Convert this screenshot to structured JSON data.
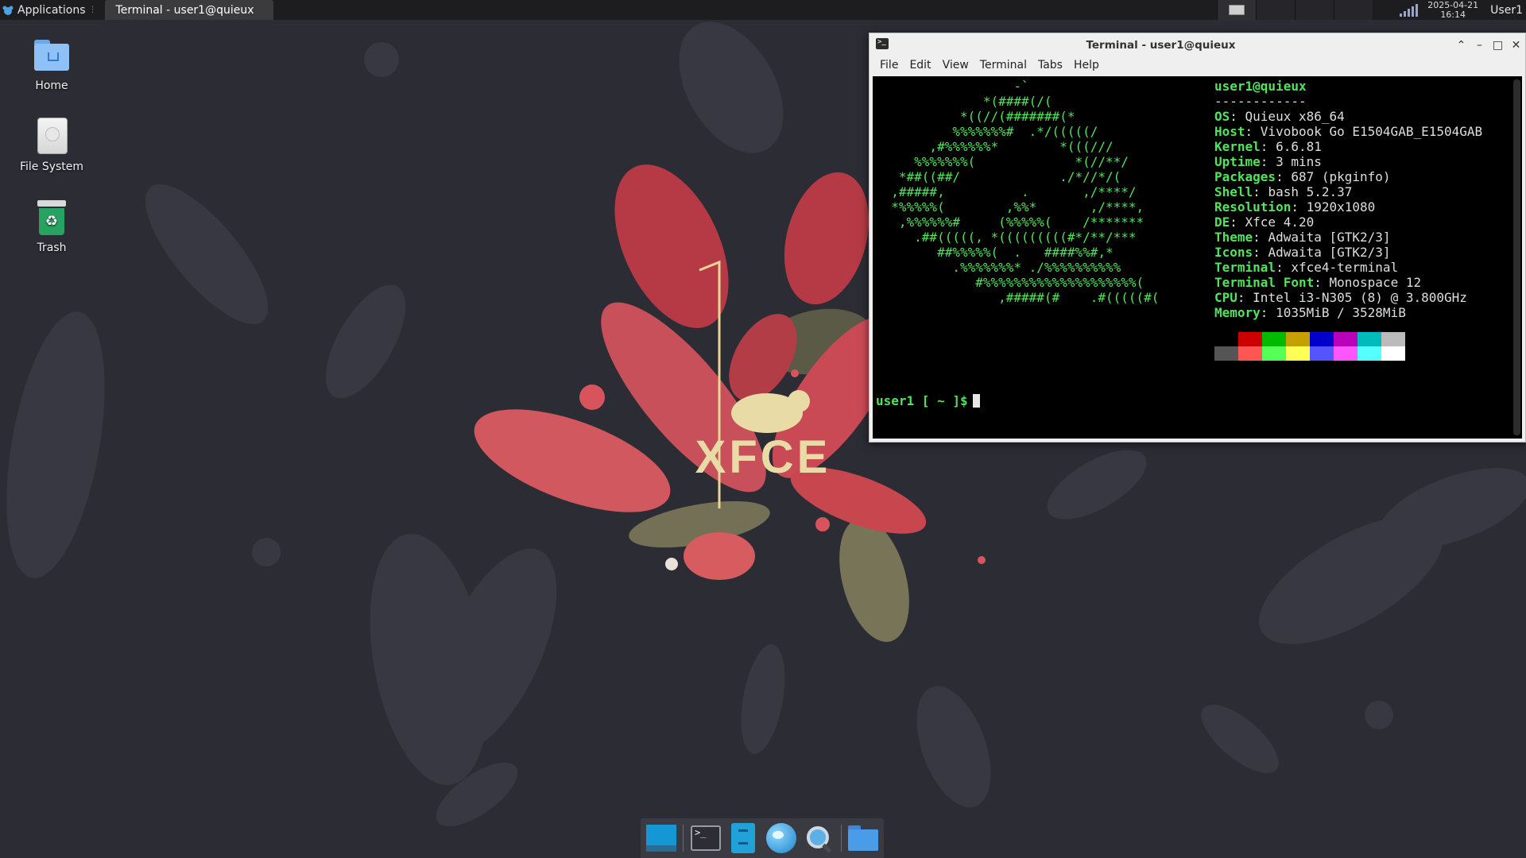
{
  "top_panel": {
    "applications_label": "Applications",
    "active_task": "Terminal - user1@quieux",
    "clock_date": "2025-04-21",
    "clock_time": "16:14",
    "user": "User1"
  },
  "desktop_icons": [
    {
      "label": "Home",
      "icon": "home-folder-icon"
    },
    {
      "label": "File System",
      "icon": "drive-icon"
    },
    {
      "label": "Trash",
      "icon": "trash-icon"
    }
  ],
  "wallpaper": {
    "logo_text": "XFCE"
  },
  "terminal": {
    "title": "Terminal - user1@quieux",
    "menu": [
      "File",
      "Edit",
      "View",
      "Terminal",
      "Tabs",
      "Help"
    ],
    "ascii_art": "                  -`\n              *(####(/(\n           *((//(#######(*\n          %%%%%%%#  .*/(((((/\n       ,#%%%%%%*        *(((///\n     %%%%%%%(             *(//**/\n   *##((##/             ./*//*/(\n  ,#####,          .       ,/****/\n  *%%%%%(        ,%%*       ,/****,\n   ,%%%%%%#     (%%%%%(    /*******\n     .##(((((, *(((((((((#*/**/***\n        ##%%%%%(  .   ####%%#,*\n          .%%%%%%%* ./%%%%%%%%%%\n             #%%%%%%%%%%%%%%%%%%%%(\n                ,#####(#    .#(((((#(",
    "userhost": "user1@quieux",
    "separator": "------------",
    "info": [
      {
        "key": "OS",
        "value": "Quieux x86_64"
      },
      {
        "key": "Host",
        "value": "Vivobook Go E1504GAB_E1504GAB"
      },
      {
        "key": "Kernel",
        "value": "6.6.81"
      },
      {
        "key": "Uptime",
        "value": "3 mins"
      },
      {
        "key": "Packages",
        "value": "687 (pkginfo)"
      },
      {
        "key": "Shell",
        "value": "bash 5.2.37"
      },
      {
        "key": "Resolution",
        "value": "1920x1080"
      },
      {
        "key": "DE",
        "value": "Xfce 4.20"
      },
      {
        "key": "Theme",
        "value": "Adwaita [GTK2/3]"
      },
      {
        "key": "Icons",
        "value": "Adwaita [GTK2/3]"
      },
      {
        "key": "Terminal",
        "value": "xfce4-terminal"
      },
      {
        "key": "Terminal Font",
        "value": "Monospace 12"
      },
      {
        "key": "CPU",
        "value": "Intel i3-N305 (8) @ 3.800GHz"
      },
      {
        "key": "Memory",
        "value": "1035MiB / 3528MiB"
      }
    ],
    "palette_colors": [
      "#000000",
      "#cc0000",
      "#00bb00",
      "#c4a000",
      "#0000cc",
      "#bb00bb",
      "#00bbbb",
      "#bbbbbb",
      "#555555",
      "#ff5555",
      "#55ff55",
      "#ffff55",
      "#5555ff",
      "#ff55ff",
      "#55ffff",
      "#ffffff"
    ],
    "prompt": "user1 [ ~ ]$"
  },
  "dock": [
    {
      "name": "show-desktop",
      "icon": "show-desktop-icon"
    },
    {
      "name": "terminal",
      "icon": "terminal-icon"
    },
    {
      "name": "file-manager",
      "icon": "file-manager-icon"
    },
    {
      "name": "web-browser",
      "icon": "web-browser-icon"
    },
    {
      "name": "app-finder",
      "icon": "search-icon"
    },
    {
      "name": "folder",
      "icon": "folder-icon"
    }
  ],
  "colors": {
    "accent_green": "#52e35b",
    "panel": "#1d1d1f",
    "desktop": "#2c2c35"
  }
}
